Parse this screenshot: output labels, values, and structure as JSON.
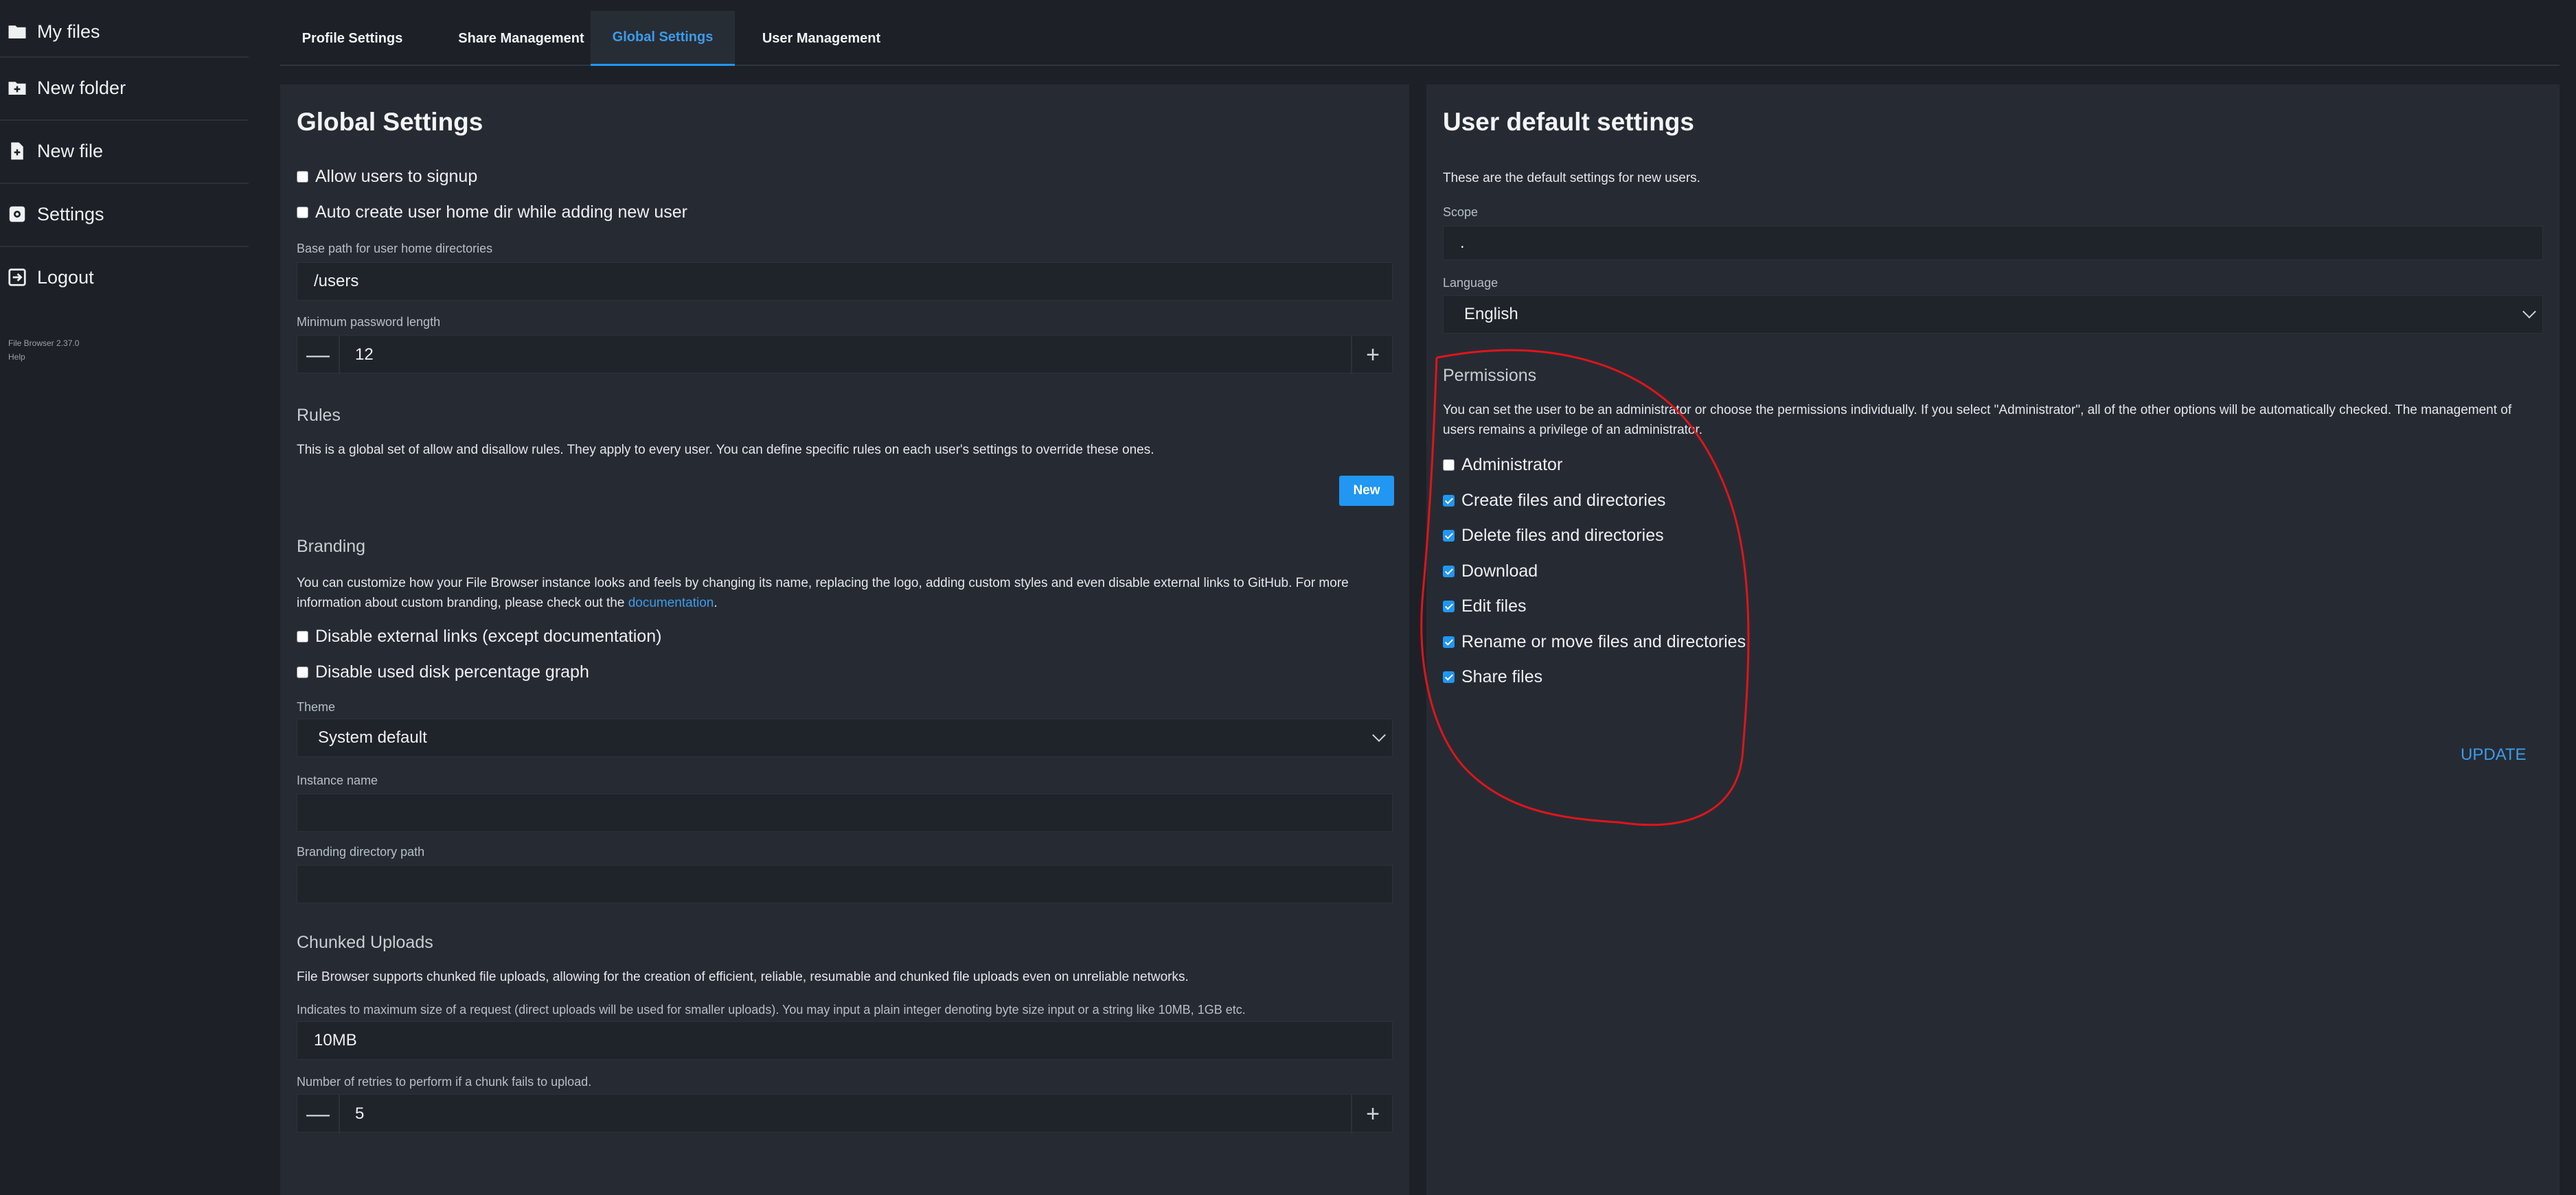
{
  "sidebar": {
    "items": [
      {
        "label": "My files",
        "icon": "folder-icon"
      },
      {
        "label": "New folder",
        "icon": "folder-plus-icon"
      },
      {
        "label": "New file",
        "icon": "file-plus-icon"
      },
      {
        "label": "Settings",
        "icon": "gear-icon"
      },
      {
        "label": "Logout",
        "icon": "logout-icon"
      }
    ],
    "version": "File Browser 2.37.0",
    "help": "Help"
  },
  "tabs": [
    {
      "label": "Profile Settings"
    },
    {
      "label": "Share Management"
    },
    {
      "label": "Global Settings",
      "active": true
    },
    {
      "label": "User Management"
    }
  ],
  "global": {
    "title": "Global Settings",
    "allow_signup": {
      "label": "Allow users to signup",
      "checked": false
    },
    "auto_home": {
      "label": "Auto create user home dir while adding new user",
      "checked": false
    },
    "base_path": {
      "label": "Base path for user home directories",
      "value": "/users"
    },
    "min_password": {
      "label": "Minimum password length",
      "value": "12"
    },
    "rules": {
      "title": "Rules",
      "desc": "This is a global set of allow and disallow rules. They apply to every user. You can define specific rules on each user's settings to override these ones.",
      "new_label": "New"
    },
    "branding": {
      "title": "Branding",
      "desc_line1": "You can customize how your File Browser instance looks and feels by changing its name, replacing the logo, adding custom styles and even disable external links to GitHub. For more",
      "desc_line2_pre": "information about custom branding, please check out the ",
      "desc_link": "documentation",
      "desc_line2_post": ".",
      "disable_links": {
        "label": "Disable external links (except documentation)",
        "checked": false
      },
      "disable_disk": {
        "label": "Disable used disk percentage graph",
        "checked": false
      },
      "theme_label": "Theme",
      "theme_value": "System default",
      "instance_label": "Instance name",
      "instance_value": "",
      "dir_label": "Branding directory path",
      "dir_value": ""
    },
    "chunked": {
      "title": "Chunked Uploads",
      "desc": "File Browser supports chunked file uploads, allowing for the creation of efficient, reliable, resumable and chunked file uploads even on unreliable networks.",
      "size_label": "Indicates to maximum size of a request (direct uploads will be used for smaller uploads). You may input a plain integer denoting byte size input or a string like 10MB, 1GB etc.",
      "size_value": "10MB",
      "retries_label": "Number of retries to perform if a chunk fails to upload.",
      "retries_value": "5"
    }
  },
  "user_defaults": {
    "title": "User default settings",
    "desc": "These are the default settings for new users.",
    "scope_label": "Scope",
    "scope_value": ".",
    "language_label": "Language",
    "language_value": "English",
    "permissions": {
      "title": "Permissions",
      "desc_line1": "You can set the user to be an administrator or choose the permissions individually. If you select \"Administrator\", all of the other options will be automatically checked. The management of",
      "desc_line2": "users remains a privilege of an administrator.",
      "items": [
        {
          "label": "Administrator",
          "checked": false
        },
        {
          "label": "Create files and directories",
          "checked": true
        },
        {
          "label": "Delete files and directories",
          "checked": true
        },
        {
          "label": "Download",
          "checked": true
        },
        {
          "label": "Edit files",
          "checked": true
        },
        {
          "label": "Rename or move files and directories",
          "checked": true
        },
        {
          "label": "Share files",
          "checked": true
        }
      ]
    },
    "update_label": "UPDATE"
  },
  "colors": {
    "accent": "#2196f3",
    "annotation": "#e0141c",
    "background": "#1d2127",
    "card": "#262b33"
  }
}
